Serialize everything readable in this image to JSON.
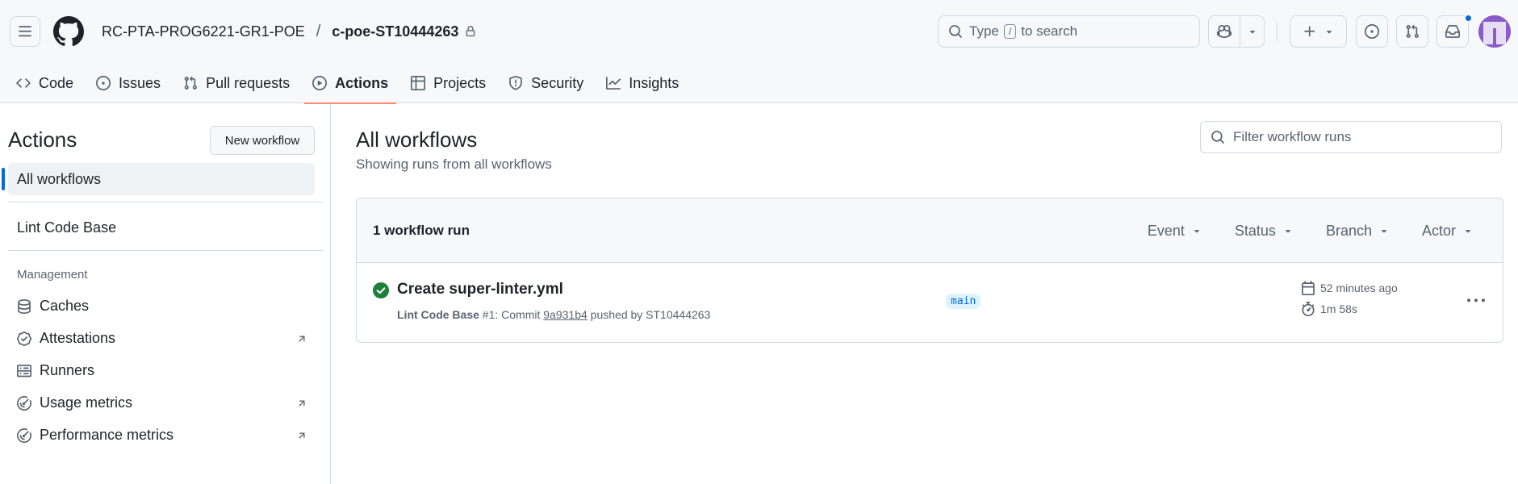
{
  "header": {
    "owner": "RC-PTA-PROG6221-GR1-POE",
    "separator": "/",
    "repo": "c-poe-ST10444263",
    "search": {
      "pre": "Type",
      "key": "/",
      "post": "to search"
    }
  },
  "tabs": [
    {
      "label": "Code",
      "icon": "code-icon"
    },
    {
      "label": "Issues",
      "icon": "issue-icon"
    },
    {
      "label": "Pull requests",
      "icon": "pull-request-icon"
    },
    {
      "label": "Actions",
      "icon": "play-icon",
      "active": true
    },
    {
      "label": "Projects",
      "icon": "table-icon"
    },
    {
      "label": "Security",
      "icon": "shield-icon"
    },
    {
      "label": "Insights",
      "icon": "graph-icon"
    }
  ],
  "sidebar": {
    "title": "Actions",
    "new_workflow": "New workflow",
    "all_workflows": "All workflows",
    "workflows": [
      "Lint Code Base"
    ],
    "management_heading": "Management",
    "management": [
      {
        "label": "Caches",
        "icon": "database-icon",
        "external": false
      },
      {
        "label": "Attestations",
        "icon": "verified-icon",
        "external": true
      },
      {
        "label": "Runners",
        "icon": "server-icon",
        "external": false
      },
      {
        "label": "Usage metrics",
        "icon": "meter-icon",
        "external": true
      },
      {
        "label": "Performance metrics",
        "icon": "meter-icon",
        "external": true
      }
    ]
  },
  "main": {
    "title": "All workflows",
    "subtitle": "Showing runs from all workflows",
    "filter_placeholder": "Filter workflow runs",
    "run_count": "1 workflow run",
    "filters": [
      "Event",
      "Status",
      "Branch",
      "Actor"
    ],
    "runs": [
      {
        "title": "Create super-linter.yml",
        "workflow": "Lint Code Base",
        "run_number": "#1",
        "commit_prefix": ": Commit",
        "sha": "9a931b4",
        "pushed_by": "pushed by ST10444263",
        "branch": "main",
        "time_ago": "52 minutes ago",
        "duration": "1m 58s",
        "status": "success"
      }
    ]
  },
  "colors": {
    "accent": "#0969da",
    "success": "#1a7f37",
    "tab_underline": "#fd8c73"
  }
}
